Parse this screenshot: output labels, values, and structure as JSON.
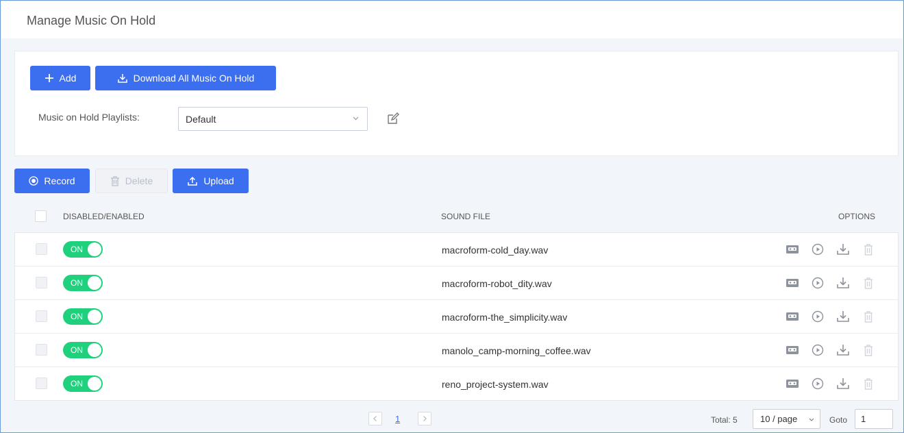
{
  "page": {
    "title": "Manage Music On Hold"
  },
  "top_actions": {
    "add_label": "Add",
    "download_all_label": "Download All Music On Hold"
  },
  "playlist": {
    "label": "Music on Hold Playlists:",
    "selected": "Default"
  },
  "file_actions": {
    "record_label": "Record",
    "delete_label": "Delete",
    "upload_label": "Upload"
  },
  "table": {
    "columns": {
      "status": "DISABLED/ENABLED",
      "sound_file": "SOUND FILE",
      "options": "OPTIONS"
    },
    "rows": [
      {
        "toggle": "ON",
        "file": "macroform-cold_day.wav"
      },
      {
        "toggle": "ON",
        "file": "macroform-robot_dity.wav"
      },
      {
        "toggle": "ON",
        "file": "macroform-the_simplicity.wav"
      },
      {
        "toggle": "ON",
        "file": "manolo_camp-morning_coffee.wav"
      },
      {
        "toggle": "ON",
        "file": "reno_project-system.wav"
      }
    ]
  },
  "pagination": {
    "current_page": "1",
    "total_text": "Total: 5",
    "page_size": "10 / page",
    "goto_label": "Goto",
    "goto_value": "1"
  },
  "colors": {
    "primary": "#3c6ef0",
    "toggle_on": "#1fd07d"
  },
  "icons": {
    "add": "plus-icon",
    "download": "download-icon",
    "record": "record-icon",
    "delete": "trash-icon",
    "upload": "upload-icon",
    "edit": "edit-icon",
    "row_options": [
      "cassette-icon",
      "play-icon",
      "download-icon",
      "trash-icon"
    ]
  }
}
